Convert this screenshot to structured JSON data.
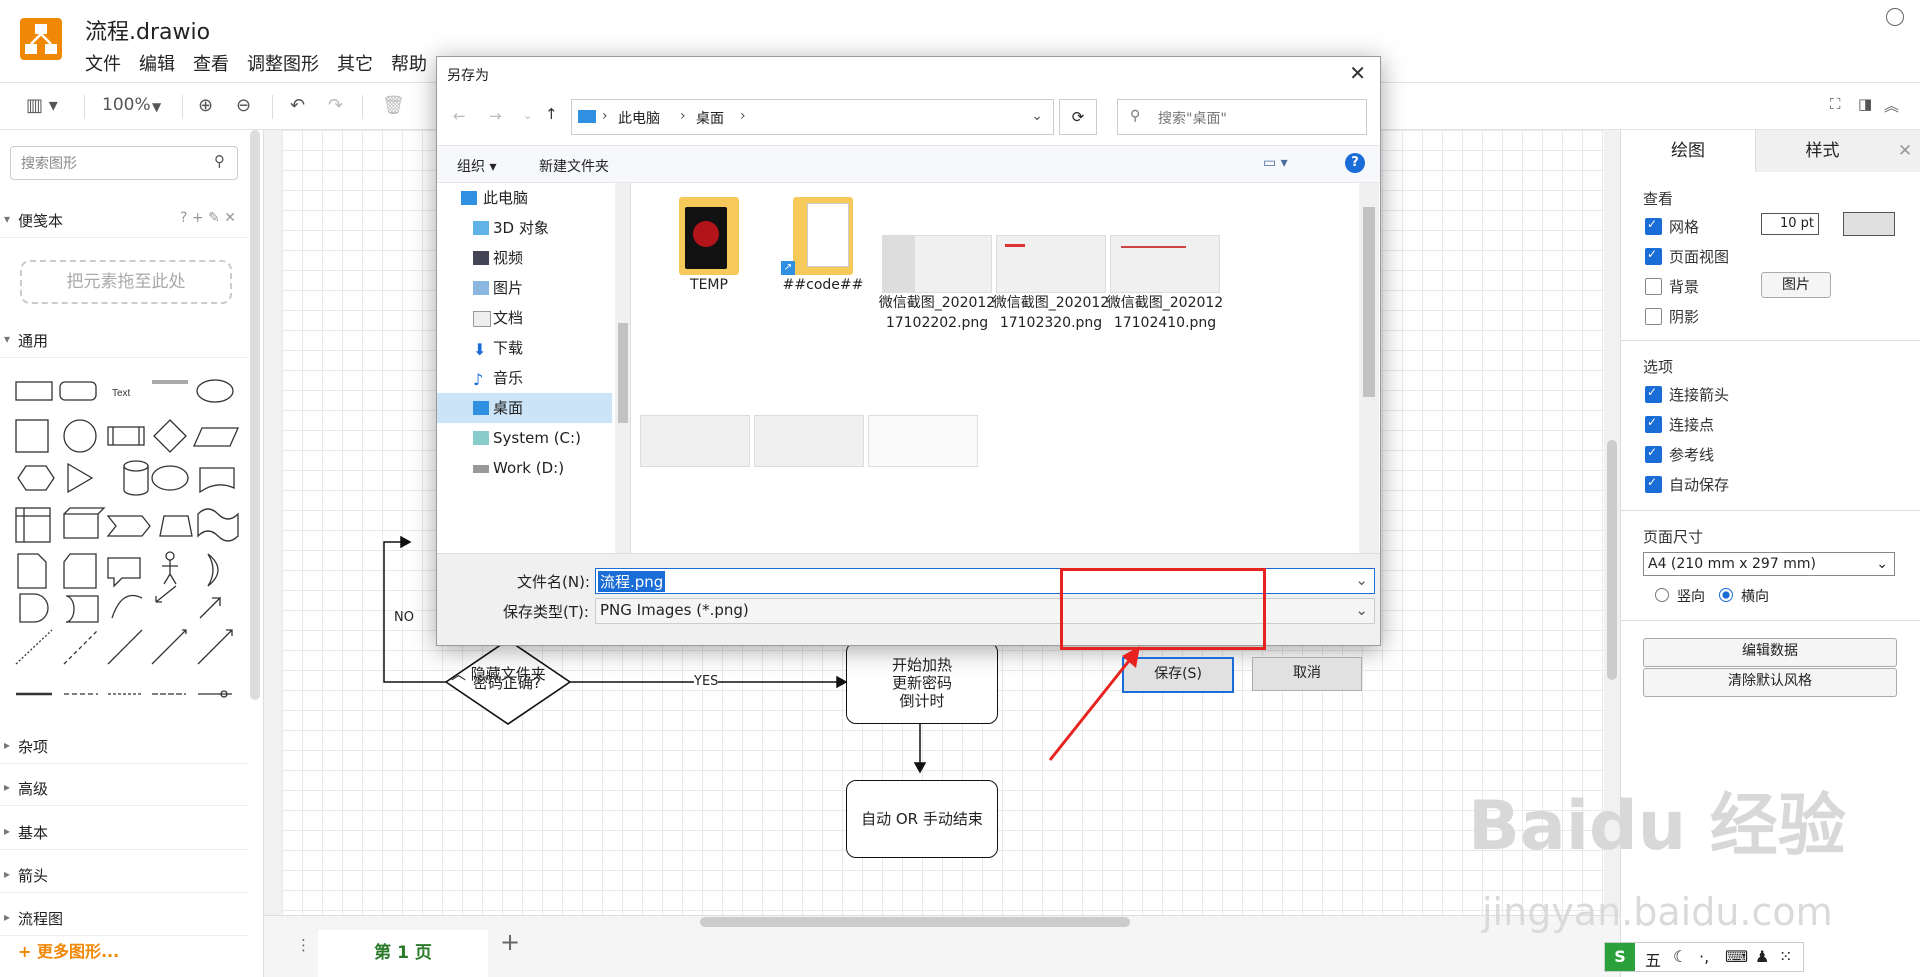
{
  "app": {
    "title": "流程.drawio"
  },
  "menu": [
    "文件",
    "编辑",
    "查看",
    "调整图形",
    "其它",
    "帮助"
  ],
  "toolbar": {
    "zoom": "100%"
  },
  "left_panel": {
    "search_placeholder": "搜索图形",
    "scratchpad_title": "便笺本",
    "scratchpad_actions": "? + ✎ ✕",
    "drop_zone": "把元素拖至此处",
    "general": "通用",
    "text_shape": "Text",
    "heading_shape": "Heading",
    "sections": [
      "杂项",
      "高级",
      "基本",
      "箭头",
      "流程图"
    ],
    "more_shapes": "+ 更多图形..."
  },
  "canvas": {
    "no_label": "NO",
    "yes_label": "YES",
    "decision": "密码正确?",
    "node_heat": "开始加热\n更新密码\n倒计时",
    "node_end": "自动 OR 手动结束"
  },
  "page_tab": "第 1 页",
  "right_panel": {
    "tabs": [
      "绘图",
      "样式"
    ],
    "view_heading": "查看",
    "grid": "网格",
    "grid_size": "10 pt",
    "page_view": "页面视图",
    "background": "背景",
    "image_btn": "图片",
    "shadow": "阴影",
    "options_heading": "选项",
    "connect_arrows": "连接箭头",
    "connect_points": "连接点",
    "guides": "参考线",
    "autosave": "自动保存",
    "page_size_heading": "页面尺寸",
    "page_size": "A4 (210 mm x 297 mm)",
    "portrait": "竖向",
    "landscape": "横向",
    "edit_data": "编辑数据",
    "clear_style": "清除默认风格",
    "checks": {
      "grid": true,
      "page_view": true,
      "background": false,
      "shadow": false,
      "connect_arrows": true,
      "connect_points": true,
      "guides": true,
      "autosave": true
    }
  },
  "dialog": {
    "title": "另存为",
    "breadcrumb": [
      "此电脑",
      "桌面"
    ],
    "search_placeholder": "搜索\"桌面\"",
    "organize": "组织 ▾",
    "new_folder": "新建文件夹",
    "nav": [
      "此电脑",
      "3D 对象",
      "视频",
      "图片",
      "文档",
      "下载",
      "音乐",
      "桌面",
      "System (C:)",
      "Work (D:)"
    ],
    "files": [
      {
        "name": "TEMP"
      },
      {
        "name": "##code##"
      },
      {
        "name": "微信截图_20201217102202.png"
      },
      {
        "name": "微信截图_20201217102320.png"
      },
      {
        "name": "微信截图_20201217102410.png"
      }
    ],
    "filename_label": "文件名(N):",
    "filename": "流程.png",
    "filetype_label": "保存类型(T):",
    "filetype": "PNG Images (*.png)",
    "hide_folders": "隐藏文件夹",
    "save": "保存(S)",
    "cancel": "取消"
  },
  "watermark": {
    "brand": "Baidu 经验",
    "site": "jingyan.baidu.com"
  },
  "ime": "五",
  "colors": {
    "accent": "#f08705",
    "highlight": "#e8231f",
    "selection": "#1a6cd6"
  }
}
